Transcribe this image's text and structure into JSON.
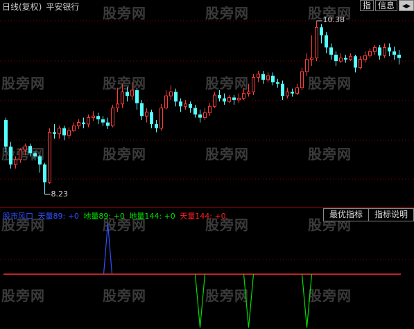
{
  "header": {
    "period": "日线(复权)",
    "stock": "平安银行",
    "buttons": [
      "指",
      "信息",
      "◂▸"
    ]
  },
  "price_labels": {
    "high": "10.38",
    "low": "8.23"
  },
  "legend": [
    {
      "text": "股市风口",
      "color": "#3050ff"
    },
    {
      "text": "天量89: +0",
      "color": "#3050ff"
    },
    {
      "text": "地量89: +0",
      "color": "#00e000"
    },
    {
      "text": "地量144: +0",
      "color": "#00e000"
    },
    {
      "text": "天量144: +0",
      "color": "#ff2020"
    }
  ],
  "panel_buttons": [
    "最优指标",
    "指标说明"
  ],
  "watermark": "股旁网",
  "colors": {
    "up": "#ff3c3c",
    "down": "#54ffff",
    "dotgrid": "#8b0000",
    "baseline": "#ff3030",
    "spike_blue": "#3050ff",
    "spike_green": "#00e000"
  },
  "candles": [
    [
      9.15,
      8.82,
      9.18,
      8.75
    ],
    [
      8.82,
      8.6,
      8.88,
      8.55
    ],
    [
      8.6,
      8.66,
      8.7,
      8.55
    ],
    [
      8.66,
      8.78,
      8.8,
      8.62
    ],
    [
      8.78,
      8.83,
      8.86,
      8.72
    ],
    [
      8.83,
      8.74,
      8.86,
      8.7
    ],
    [
      8.74,
      8.7,
      8.77,
      8.65
    ],
    [
      8.7,
      8.6,
      8.72,
      8.5
    ],
    [
      8.6,
      8.38,
      8.62,
      8.23
    ],
    [
      8.38,
      9.0,
      9.05,
      8.36
    ],
    [
      9.0,
      8.98,
      9.1,
      8.92
    ],
    [
      8.98,
      9.05,
      9.08,
      8.92
    ],
    [
      9.05,
      8.96,
      9.08,
      8.9
    ],
    [
      8.96,
      9.02,
      9.06,
      8.92
    ],
    [
      9.02,
      9.08,
      9.12,
      9.0
    ],
    [
      9.08,
      9.12,
      9.16,
      9.04
    ],
    [
      9.12,
      9.1,
      9.18,
      9.05
    ],
    [
      9.1,
      9.18,
      9.22,
      9.06
    ],
    [
      9.18,
      9.2,
      9.26,
      9.14
    ],
    [
      9.2,
      9.16,
      9.24,
      9.1
    ],
    [
      9.16,
      9.12,
      9.2,
      9.08
    ],
    [
      9.12,
      9.08,
      9.18,
      9.04
    ],
    [
      9.08,
      9.3,
      9.34,
      9.06
    ],
    [
      9.3,
      9.35,
      9.55,
      9.25
    ],
    [
      9.35,
      9.5,
      9.6,
      9.3
    ],
    [
      9.5,
      9.45,
      9.56,
      9.38
    ],
    [
      9.45,
      9.52,
      9.62,
      9.4
    ],
    [
      9.52,
      9.36,
      9.55,
      9.28
    ],
    [
      9.36,
      9.2,
      9.4,
      9.15
    ],
    [
      9.2,
      9.25,
      9.3,
      9.12
    ],
    [
      9.25,
      9.1,
      9.28,
      9.05
    ],
    [
      9.1,
      9.05,
      9.15,
      9.0
    ],
    [
      9.05,
      9.3,
      9.35,
      9.02
    ],
    [
      9.3,
      9.45,
      9.52,
      9.28
    ],
    [
      9.45,
      9.5,
      9.58,
      9.4
    ],
    [
      9.5,
      9.38,
      9.54,
      9.32
    ],
    [
      9.38,
      9.32,
      9.42,
      9.25
    ],
    [
      9.32,
      9.35,
      9.4,
      9.28
    ],
    [
      9.35,
      9.3,
      9.38,
      9.24
    ],
    [
      9.3,
      9.22,
      9.34,
      9.18
    ],
    [
      9.22,
      9.18,
      9.28,
      9.12
    ],
    [
      9.18,
      9.24,
      9.3,
      9.15
    ],
    [
      9.24,
      9.32,
      9.36,
      9.2
    ],
    [
      9.32,
      9.46,
      9.5,
      9.3
    ],
    [
      9.46,
      9.42,
      9.52,
      9.38
    ],
    [
      9.42,
      9.38,
      9.48,
      9.34
    ],
    [
      9.38,
      9.43,
      9.46,
      9.36
    ],
    [
      9.43,
      9.4,
      9.46,
      9.34
    ],
    [
      9.4,
      9.42,
      9.48,
      9.36
    ],
    [
      9.42,
      9.48,
      9.55,
      9.4
    ],
    [
      9.48,
      9.5,
      9.6,
      9.44
    ],
    [
      9.5,
      9.68,
      9.72,
      9.46
    ],
    [
      9.68,
      9.72,
      9.76,
      9.62
    ],
    [
      9.72,
      9.65,
      9.76,
      9.6
    ],
    [
      9.65,
      9.7,
      9.74,
      9.62
    ],
    [
      9.7,
      9.62,
      9.74,
      9.58
    ],
    [
      9.62,
      9.6,
      9.66,
      9.55
    ],
    [
      9.6,
      9.45,
      9.64,
      9.4
    ],
    [
      9.45,
      9.5,
      9.55,
      9.42
    ],
    [
      9.5,
      9.48,
      9.54,
      9.44
    ],
    [
      9.48,
      9.55,
      9.6,
      9.46
    ],
    [
      9.55,
      9.75,
      9.8,
      9.52
    ],
    [
      9.75,
      9.9,
      9.98,
      9.7
    ],
    [
      9.9,
      9.92,
      10.2,
      9.82
    ],
    [
      9.92,
      10.3,
      10.38,
      9.88
    ],
    [
      10.3,
      10.2,
      10.34,
      10.1
    ],
    [
      10.2,
      10.05,
      10.24,
      9.98
    ],
    [
      10.05,
      9.96,
      10.1,
      9.9
    ],
    [
      9.96,
      9.88,
      10.0,
      9.82
    ],
    [
      9.88,
      9.92,
      9.98,
      9.86
    ],
    [
      9.92,
      9.9,
      9.96,
      9.86
    ],
    [
      9.9,
      9.94,
      9.98,
      9.88
    ],
    [
      9.94,
      9.8,
      9.96,
      9.74
    ],
    [
      9.8,
      9.9,
      9.94,
      9.78
    ],
    [
      9.9,
      9.95,
      10.0,
      9.86
    ],
    [
      9.95,
      10.0,
      10.04,
      9.92
    ],
    [
      10.0,
      10.05,
      10.08,
      9.96
    ],
    [
      10.05,
      9.95,
      10.08,
      9.9
    ],
    [
      9.95,
      10.05,
      10.1,
      9.92
    ],
    [
      10.05,
      10.0,
      10.1,
      9.94
    ],
    [
      10.0,
      9.96,
      10.06,
      9.9
    ],
    [
      9.96,
      9.92,
      10.02,
      9.84
    ]
  ],
  "signals": [
    {
      "index": 21,
      "type": "up"
    },
    {
      "index": 40,
      "type": "down"
    },
    {
      "index": 50,
      "type": "down"
    },
    {
      "index": 62,
      "type": "down"
    }
  ]
}
